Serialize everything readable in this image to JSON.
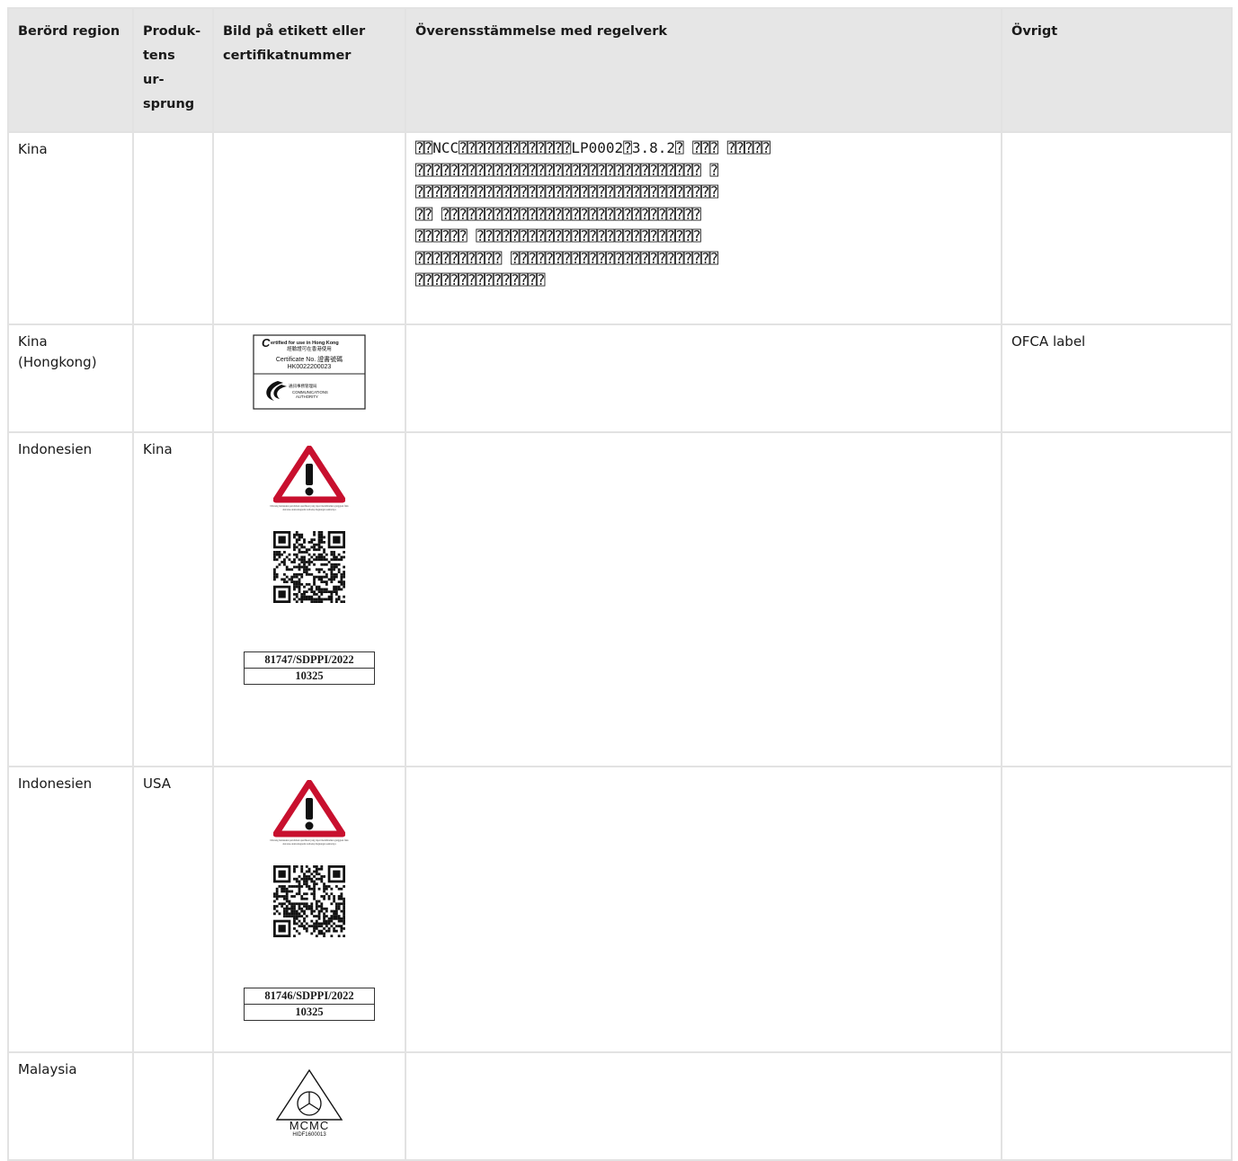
{
  "headers": {
    "region": "Berörd region",
    "origin": "Produk-\ntens\nur-\nsprung",
    "label": "Bild på etikett eller\ncertifikatnummer",
    "compliance": "Överensstämmelse med regelverk",
    "other": "Övrigt"
  },
  "rows": [
    {
      "region": "Kina",
      "origin": "",
      "compliance": "⍰⍰NCC⍰⍰⍰⍰⍰⍰⍰⍰⍰⍰⍰⍰⍰LP0002⍰3.8.2⍰ ⍰⍰⍰ ⍰⍰⍰⍰⍰\n⍰⍰⍰⍰⍰⍰⍰⍰⍰⍰⍰⍰⍰⍰⍰⍰⍰⍰⍰⍰⍰⍰⍰⍰⍰⍰⍰⍰⍰⍰⍰⍰⍰ ⍰\n⍰⍰⍰⍰⍰⍰⍰⍰⍰⍰⍰⍰⍰⍰⍰⍰⍰⍰⍰⍰⍰⍰⍰⍰⍰⍰⍰⍰⍰⍰⍰⍰⍰⍰⍰\n⍰⍰ ⍰⍰⍰⍰⍰⍰⍰⍰⍰⍰⍰⍰⍰⍰⍰⍰⍰⍰⍰⍰⍰⍰⍰⍰⍰⍰⍰⍰⍰⍰\n⍰⍰⍰⍰⍰⍰ ⍰⍰⍰⍰⍰⍰⍰⍰⍰⍰⍰⍰⍰⍰⍰⍰⍰⍰⍰⍰⍰⍰⍰⍰⍰⍰\n⍰⍰⍰⍰⍰⍰⍰⍰⍰⍰ ⍰⍰⍰⍰⍰⍰⍰⍰⍰⍰⍰⍰⍰⍰⍰⍰⍰⍰⍰⍰⍰⍰⍰⍰\n⍰⍰⍰⍰⍰⍰⍰⍰⍰⍰⍰⍰⍰⍰⍰",
      "other": ""
    },
    {
      "region": "Kina\n(Hongkong)",
      "origin": "",
      "compliance": "",
      "other": "OFCA label",
      "ofca": {
        "line1_cap": "C",
        "line1": "ertified for use in Hong Kong",
        "line2": "經驗證可在香港使用",
        "line3": "Certificate No. 證書號碼",
        "line4": "HK0022200023",
        "agency_zh": "通訊事務管理局",
        "agency_en1": "COMMUNICATIONS",
        "agency_en2": "AUTHORITY"
      }
    },
    {
      "region": "Indonesien",
      "origin": "Kina",
      "compliance": "",
      "other": "",
      "warning_text": "Dilarang melakukan perubahan spesifikasi yang dapat menimbulkan gangguan fisik dan/atau elektromagnetik terhadap lingkungan sekitarnya",
      "cert_number": "81747/SDPPI/2022",
      "cert_code": "10325"
    },
    {
      "region": "Indonesien",
      "origin": "USA",
      "compliance": "",
      "other": "",
      "warning_text": "Dilarang melakukan perubahan spesifikasi yang dapat menimbulkan gangguan fisik dan/atau elektromagnetik terhadap lingkungan sekitarnya",
      "cert_number": "81746/SDPPI/2022",
      "cert_code": "10325"
    },
    {
      "region": "Malaysia",
      "origin": "",
      "compliance": "",
      "other": "",
      "mcmc_brand": "MCMC",
      "mcmc_code": "HIDF1600013"
    }
  ],
  "icons": [
    "ofca-certified-label",
    "warning-triangle-icon",
    "qr-code",
    "mcmc-triangle-logo"
  ],
  "colors": {
    "header_bg": "#e6e6e6",
    "grid_border": "#e2e2e2",
    "warning_red": "#c8102e",
    "text": "#1a1a1a"
  }
}
